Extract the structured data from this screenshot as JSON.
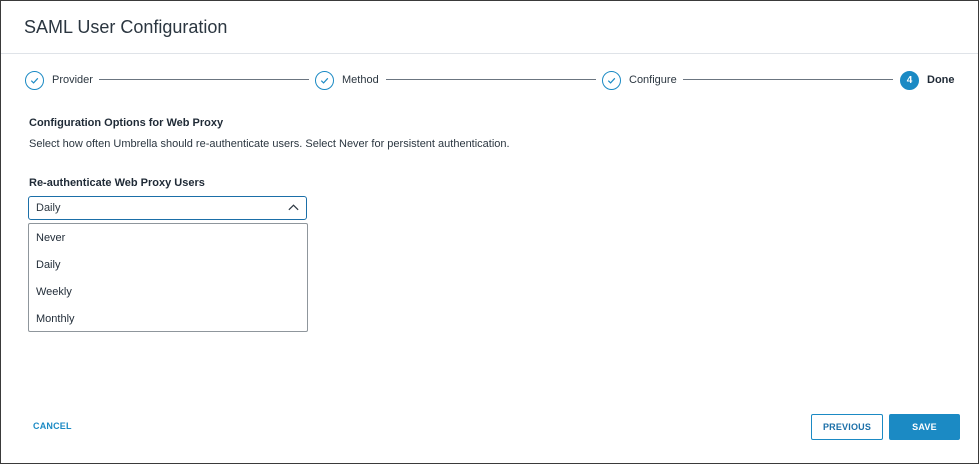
{
  "dialog": {
    "title": "SAML User Configuration"
  },
  "stepper": {
    "steps": [
      {
        "label": "Provider",
        "state": "completed",
        "icon": "check-icon"
      },
      {
        "label": "Method",
        "state": "completed",
        "icon": "check-icon"
      },
      {
        "label": "Configure",
        "state": "completed",
        "icon": "check-icon"
      },
      {
        "label": "Done",
        "state": "active",
        "number": "4"
      }
    ]
  },
  "content": {
    "section_title": "Configuration Options for Web Proxy",
    "section_description": "Select how often Umbrella should re-authenticate users. Select Never for persistent authentication.",
    "field_label": "Re-authenticate Web Proxy Users",
    "select": {
      "value": "Daily",
      "options": [
        "Never",
        "Daily",
        "Weekly",
        "Monthly"
      ]
    }
  },
  "footer": {
    "cancel_label": "CANCEL",
    "previous_label": "PREVIOUS",
    "save_label": "SAVE"
  },
  "colors": {
    "accent": "#1b8ac4",
    "border": "#3a3a3a",
    "text": "#2b3640"
  }
}
